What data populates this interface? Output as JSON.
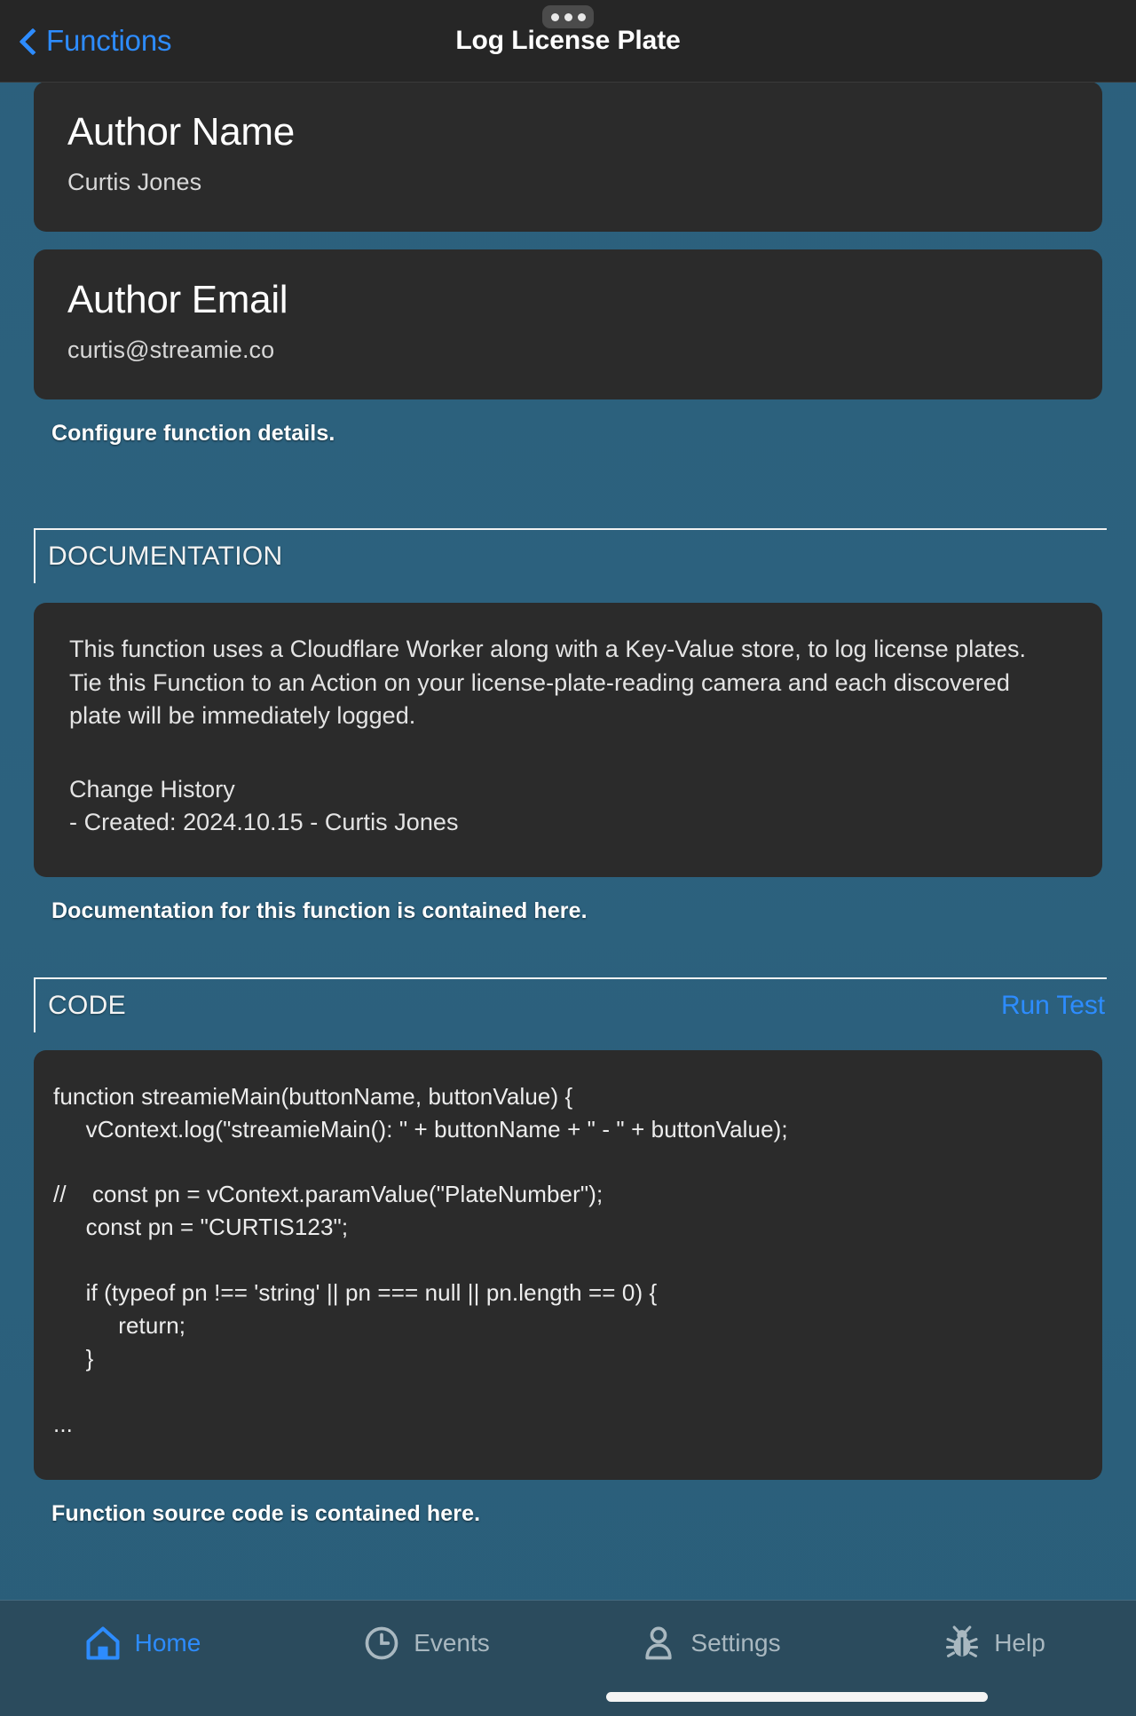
{
  "navbar": {
    "back_label": "Functions",
    "title": "Log License Plate",
    "back_icon": "chevron-left-icon",
    "multitask_icon": "ellipsis-pill-icon"
  },
  "fields": [
    {
      "label": "Author Name",
      "value": "Curtis Jones"
    },
    {
      "label": "Author Email",
      "value": "curtis@streamie.co"
    }
  ],
  "captions": {
    "details": "Configure function details.",
    "documentation": "Documentation for this function is contained here.",
    "code": "Function source code is contained here."
  },
  "documentation_section": {
    "header": "DOCUMENTATION",
    "body": "This function uses a Cloudflare Worker along with a Key-Value store, to log license plates.\nTie this Function to an Action on your license-plate-reading camera and each discovered\nplate will be immediately logged.",
    "change_history_title": "Change History",
    "change_history_entry": "- Created: 2024.10.15 - Curtis Jones"
  },
  "code_section": {
    "header": "CODE",
    "action": "Run Test",
    "source": "function streamieMain(buttonName, buttonValue) {\n     vContext.log(\"streamieMain(): \" + buttonName + \" - \" + buttonValue);\n\n//    const pn = vContext.paramValue(\"PlateNumber\");\n     const pn = \"CURTIS123\";\n\n     if (typeof pn !== 'string' || pn === null || pn.length == 0) {\n          return;\n     }\n\n..."
  },
  "tabbar": {
    "items": [
      {
        "label": "Home",
        "icon": "home-icon",
        "active": true
      },
      {
        "label": "Events",
        "icon": "clock-icon",
        "active": false
      },
      {
        "label": "Settings",
        "icon": "person-icon",
        "active": false
      },
      {
        "label": "Help",
        "icon": "bug-icon",
        "active": false
      }
    ]
  },
  "colors": {
    "accent": "#2d8cff",
    "card": "#2b2b2b",
    "navbar": "#262626",
    "tabbar": "#2b4b5d",
    "background": "#2d6380"
  }
}
